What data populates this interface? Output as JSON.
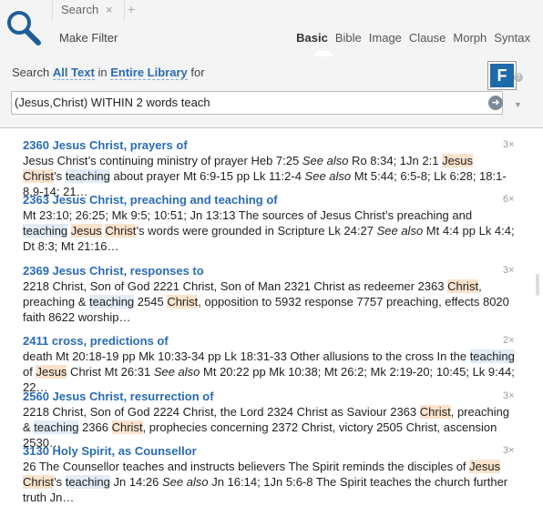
{
  "tab": {
    "label": "Search",
    "close": "×",
    "add": "+"
  },
  "toolbar": {
    "make_filter": "Make Filter"
  },
  "modes": [
    "Basic",
    "Bible",
    "Image",
    "Clause",
    "Morph",
    "Syntax"
  ],
  "active_mode": "Basic",
  "query": {
    "prefix": "Search",
    "scope_text": "All Text",
    "mid": "in",
    "library": "Entire Library",
    "suffix": "for",
    "value": "(Jesus,Christ) WITHIN 2 words teach"
  },
  "logo": "F",
  "help": "?",
  "results": [
    {
      "title": "2360 Jesus Christ, prayers of",
      "count": "3×"
    },
    {
      "title": "2363 Jesus Christ, preaching and teaching of",
      "count": "6×"
    },
    {
      "title": "2369 Jesus Christ, responses to",
      "count": "3×"
    },
    {
      "title": "2411 cross, predictions of",
      "count": "2×"
    },
    {
      "title": "2560 Jesus Christ, resurrection of",
      "count": "3×"
    },
    {
      "title": "3130 Holy Spirit, as Counsellor",
      "count": "3×"
    }
  ],
  "colors": {
    "accent": "#2a6cb3",
    "highlight_orange": "#fce3cc",
    "highlight_blue": "#e3ecf7"
  }
}
